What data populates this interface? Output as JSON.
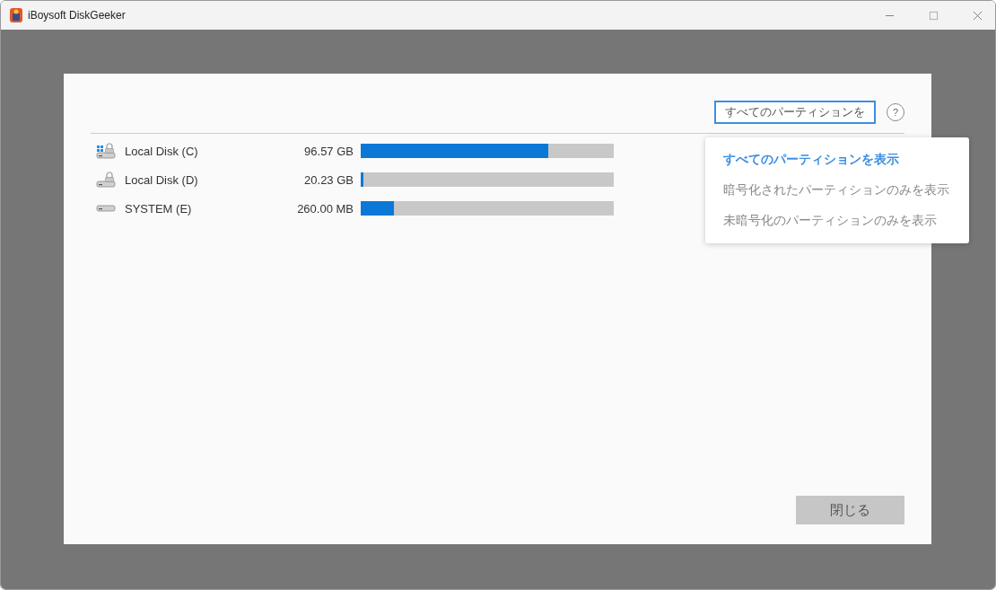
{
  "window": {
    "title": "iBoysoft DiskGeeker"
  },
  "filter": {
    "value": "すべてのパーティションを",
    "expanded": true,
    "options": [
      {
        "label": "すべてのパーティションを表示",
        "selected": true
      },
      {
        "label": "暗号化されたパーティションのみを表示",
        "selected": false
      },
      {
        "label": "未暗号化のパーティションのみを表示",
        "selected": false
      }
    ]
  },
  "help": {
    "label": "?"
  },
  "partitions": [
    {
      "name": "Local Disk (C)",
      "kind": "system",
      "size": "96.57 GB",
      "level": 0.74
    },
    {
      "name": "Local Disk (D)",
      "kind": "locked",
      "size": "20.23 GB",
      "level": 0.006
    },
    {
      "name": "SYSTEM (E)",
      "kind": "plain",
      "size": "260.00 MB",
      "level": 0.13
    }
  ],
  "close_button": {
    "label": "閉じる"
  }
}
